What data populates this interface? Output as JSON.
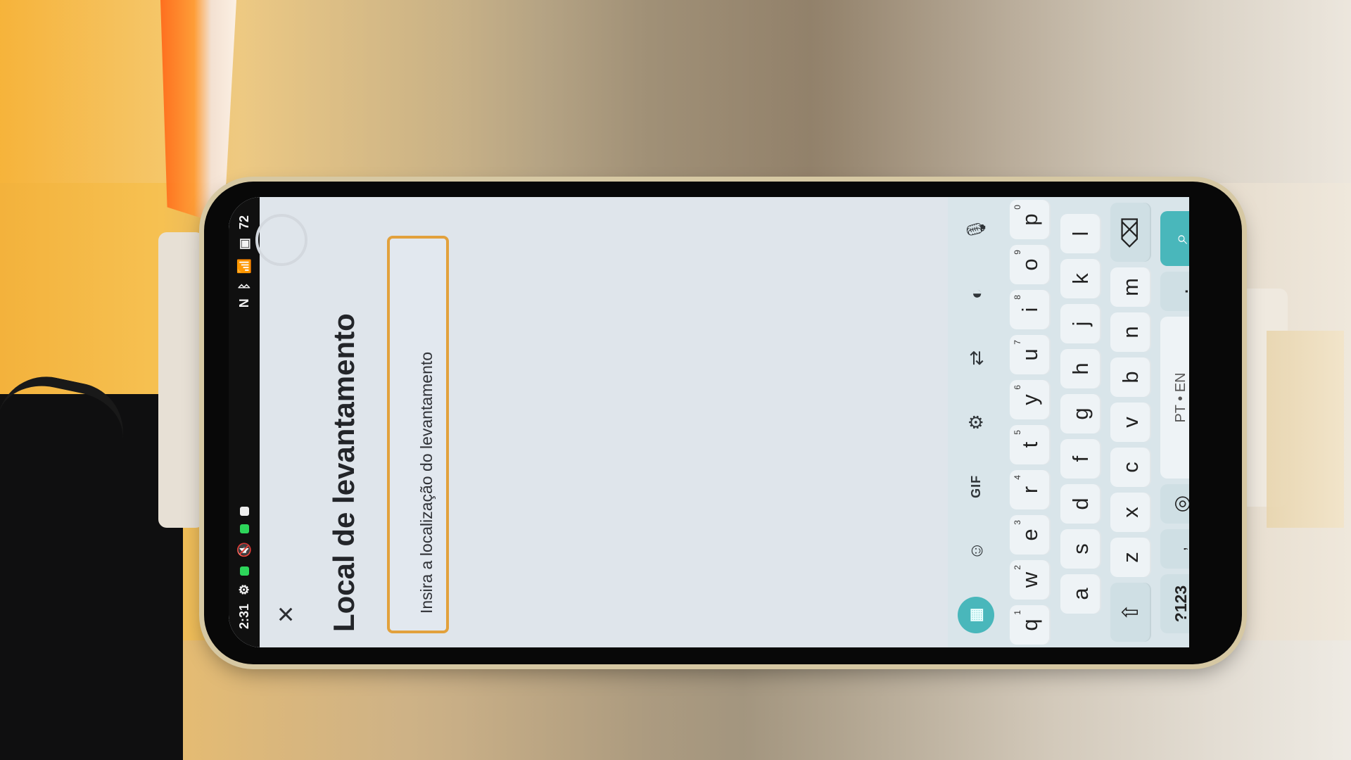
{
  "status_bar": {
    "time": "2:31",
    "battery": "72",
    "icons": [
      "settings-status-icon",
      "green-chat-icon",
      "mute-icon",
      "green-app-icon",
      "notification-icon",
      "nfc-icon",
      "bluetooth-icon",
      "wifi-icon",
      "sim-icon",
      "battery-icon"
    ]
  },
  "header": {
    "close_icon": "×",
    "title": "Local de levantamento"
  },
  "location_input": {
    "placeholder": "Insira a localização do levantamento",
    "value": ""
  },
  "keyboard": {
    "toolbar": {
      "apps_icon": "▦",
      "sticker_icon": "☺",
      "gif_label": "GIF",
      "settings_icon": "⚙",
      "translate_icon": "⇄",
      "theme_icon": "◐",
      "mic_icon": "🎙"
    },
    "rows": {
      "row1": [
        {
          "label": "q",
          "num": "1"
        },
        {
          "label": "w",
          "num": "2"
        },
        {
          "label": "e",
          "num": "3"
        },
        {
          "label": "r",
          "num": "4"
        },
        {
          "label": "t",
          "num": "5"
        },
        {
          "label": "y",
          "num": "6"
        },
        {
          "label": "u",
          "num": "7"
        },
        {
          "label": "i",
          "num": "8"
        },
        {
          "label": "o",
          "num": "9"
        },
        {
          "label": "p",
          "num": "0"
        }
      ],
      "row2": [
        "a",
        "s",
        "d",
        "f",
        "g",
        "h",
        "j",
        "k",
        "l"
      ],
      "row3": [
        "z",
        "x",
        "c",
        "v",
        "b",
        "n",
        "m"
      ],
      "row4": {
        "symbols_label": "?123",
        "comma_label": ",",
        "globe_icon": "◎",
        "space_label": "PT • EN",
        "period_label": ".",
        "search_icon": "⌕"
      }
    },
    "shift_icon": "⇧",
    "backspace_icon": "⌫"
  },
  "nav_bar": {
    "back_icon": "◀",
    "home_icon": "●",
    "recents_icon": "■"
  }
}
